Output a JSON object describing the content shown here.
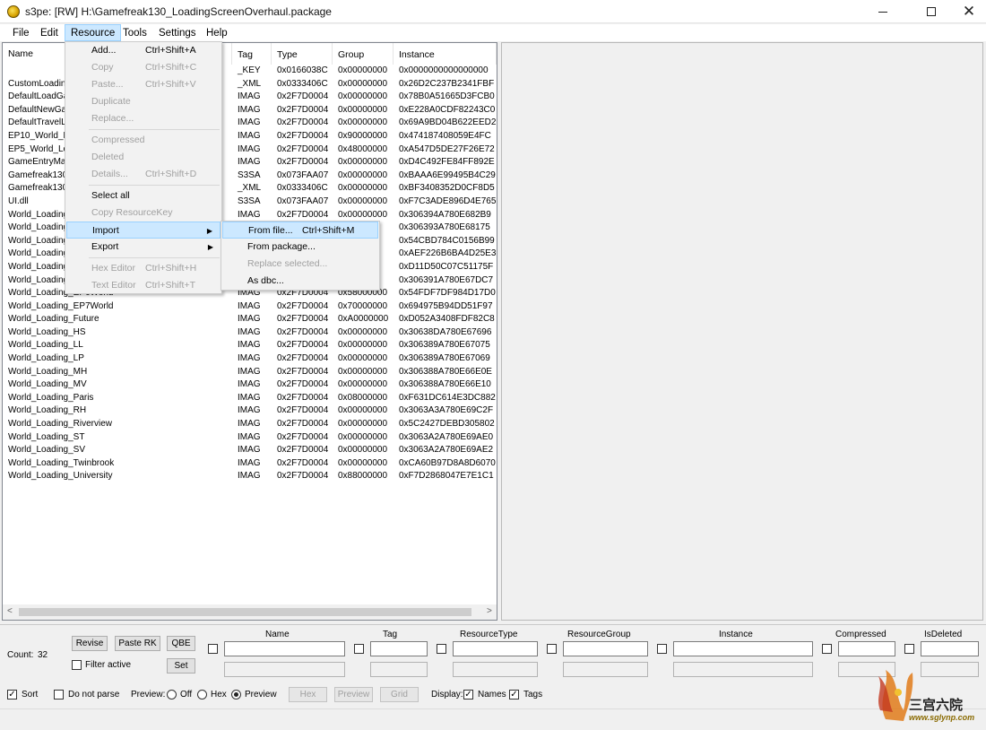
{
  "window": {
    "title": "s3pe: [RW] H:\\Gamefreak130_LoadingScreenOverhaul.package",
    "close_glyph": "✕"
  },
  "menubar": [
    "File",
    "Edit",
    "Resource",
    "Tools",
    "Settings",
    "Help"
  ],
  "list": {
    "columns": [
      "Name",
      "Tag",
      "Type",
      "Group",
      "Instance"
    ],
    "rows": [
      {
        "name": "",
        "tag": "_KEY",
        "type": "0x0166038C",
        "group": "0x00000000",
        "instance": "0x0000000000000000"
      },
      {
        "name": "CustomLoading",
        "tag": "_XML",
        "type": "0x0333406C",
        "group": "0x00000000",
        "instance": "0x26D2C237B2341FBF"
      },
      {
        "name": "DefaultLoadGa",
        "tag": "IMAG",
        "type": "0x2F7D0004",
        "group": "0x00000000",
        "instance": "0x78B0A51665D3FCB0"
      },
      {
        "name": "DefaultNewGar",
        "tag": "IMAG",
        "type": "0x2F7D0004",
        "group": "0x00000000",
        "instance": "0xE228A0CDF82243C0"
      },
      {
        "name": "DefaultTravelLo",
        "tag": "IMAG",
        "type": "0x2F7D0004",
        "group": "0x00000000",
        "instance": "0x69A9BD04B622EED2"
      },
      {
        "name": "EP10_World_L",
        "tag": "IMAG",
        "type": "0x2F7D0004",
        "group": "0x90000000",
        "instance": "0x474187408059E4FC"
      },
      {
        "name": "EP5_World_Lo",
        "tag": "IMAG",
        "type": "0x2F7D0004",
        "group": "0x48000000",
        "instance": "0xA547D5DE27F26E72"
      },
      {
        "name": "GameEntryMain",
        "tag": "IMAG",
        "type": "0x2F7D0004",
        "group": "0x00000000",
        "instance": "0xD4C492FE84FF892E"
      },
      {
        "name": "Gamefreak130.",
        "tag": "S3SA",
        "type": "0x073FAA07",
        "group": "0x00000000",
        "instance": "0xBAAA6E99495B4C29"
      },
      {
        "name": "Gamefreak130.",
        "tag": "_XML",
        "type": "0x0333406C",
        "group": "0x00000000",
        "instance": "0xBF3408352D0CF8D5"
      },
      {
        "name": "UI.dll",
        "tag": "S3SA",
        "type": "0x073FAA07",
        "group": "0x00000000",
        "instance": "0xF7C3ADE896D4E765"
      },
      {
        "name": "World_Loading",
        "tag": "IMAG",
        "type": "0x2F7D0004",
        "group": "0x00000000",
        "instance": "0x306394A780E682B9"
      },
      {
        "name": "World_Loading",
        "tag": "",
        "type": "",
        "group": "",
        "instance": "0x306393A780E68175"
      },
      {
        "name": "World_Loading",
        "tag": "",
        "type": "",
        "group": "",
        "instance": "0x54CBD784C0156B99"
      },
      {
        "name": "World_Loading",
        "tag": "",
        "type": "",
        "group": "",
        "instance": "0xAEF226B6BA4D25E3"
      },
      {
        "name": "World_Loading",
        "tag": "",
        "type": "",
        "group": "",
        "instance": "0xD11D50C07C51175F"
      },
      {
        "name": "World_Loading",
        "tag": "",
        "type": "",
        "group": "",
        "instance": "0x306391A780E67DC7"
      },
      {
        "name": "World_Loading_EP6World",
        "tag": "IMAG",
        "type": "0x2F7D0004",
        "group": "0x58000000",
        "instance": "0x54FDF7DF984D17D0"
      },
      {
        "name": "World_Loading_EP7World",
        "tag": "IMAG",
        "type": "0x2F7D0004",
        "group": "0x70000000",
        "instance": "0x694975B94DD51F97"
      },
      {
        "name": "World_Loading_Future",
        "tag": "IMAG",
        "type": "0x2F7D0004",
        "group": "0xA0000000",
        "instance": "0xD052A3408FDF82C8"
      },
      {
        "name": "World_Loading_HS",
        "tag": "IMAG",
        "type": "0x2F7D0004",
        "group": "0x00000000",
        "instance": "0x30638DA780E67696"
      },
      {
        "name": "World_Loading_LL",
        "tag": "IMAG",
        "type": "0x2F7D0004",
        "group": "0x00000000",
        "instance": "0x306389A780E67075"
      },
      {
        "name": "World_Loading_LP",
        "tag": "IMAG",
        "type": "0x2F7D0004",
        "group": "0x00000000",
        "instance": "0x306389A780E67069"
      },
      {
        "name": "World_Loading_MH",
        "tag": "IMAG",
        "type": "0x2F7D0004",
        "group": "0x00000000",
        "instance": "0x306388A780E66E0E"
      },
      {
        "name": "World_Loading_MV",
        "tag": "IMAG",
        "type": "0x2F7D0004",
        "group": "0x00000000",
        "instance": "0x306388A780E66E10"
      },
      {
        "name": "World_Loading_Paris",
        "tag": "IMAG",
        "type": "0x2F7D0004",
        "group": "0x08000000",
        "instance": "0xF631DC614E3DC882"
      },
      {
        "name": "World_Loading_RH",
        "tag": "IMAG",
        "type": "0x2F7D0004",
        "group": "0x00000000",
        "instance": "0x3063A3A780E69C2F"
      },
      {
        "name": "World_Loading_Riverview",
        "tag": "IMAG",
        "type": "0x2F7D0004",
        "group": "0x00000000",
        "instance": "0x5C2427DEBD305802"
      },
      {
        "name": "World_Loading_ST",
        "tag": "IMAG",
        "type": "0x2F7D0004",
        "group": "0x00000000",
        "instance": "0x3063A2A780E69AE0"
      },
      {
        "name": "World_Loading_SV",
        "tag": "IMAG",
        "type": "0x2F7D0004",
        "group": "0x00000000",
        "instance": "0x3063A2A780E69AE2"
      },
      {
        "name": "World_Loading_Twinbrook",
        "tag": "IMAG",
        "type": "0x2F7D0004",
        "group": "0x00000000",
        "instance": "0xCA60B97D8A8D6070"
      },
      {
        "name": "World_Loading_University",
        "tag": "IMAG",
        "type": "0x2F7D0004",
        "group": "0x88000000",
        "instance": "0xF7D2868047E7E1C1"
      }
    ]
  },
  "resource_menu": {
    "items": [
      {
        "label": "Add...",
        "shortcut": "Ctrl+Shift+A",
        "enabled": true
      },
      {
        "label": "Copy",
        "shortcut": "Ctrl+Shift+C",
        "enabled": false
      },
      {
        "label": "Paste...",
        "shortcut": "Ctrl+Shift+V",
        "enabled": false
      },
      {
        "label": "Duplicate",
        "shortcut": "",
        "enabled": false
      },
      {
        "label": "Replace...",
        "shortcut": "",
        "enabled": false
      },
      {
        "label": "Compressed",
        "shortcut": "",
        "enabled": false
      },
      {
        "label": "Deleted",
        "shortcut": "",
        "enabled": false
      },
      {
        "label": "Details...",
        "shortcut": "Ctrl+Shift+D",
        "enabled": false
      },
      {
        "label": "Select all",
        "shortcut": "",
        "enabled": true
      },
      {
        "label": "Copy ResourceKey",
        "shortcut": "",
        "enabled": false
      },
      {
        "label": "Import",
        "shortcut": "",
        "enabled": true,
        "submenu": true,
        "highlighted": true
      },
      {
        "label": "Export",
        "shortcut": "",
        "enabled": true,
        "submenu": true
      },
      {
        "label": "Hex Editor",
        "shortcut": "Ctrl+Shift+H",
        "enabled": false
      },
      {
        "label": "Text Editor",
        "shortcut": "Ctrl+Shift+T",
        "enabled": false
      }
    ],
    "arrow_glyph": "▶"
  },
  "import_submenu": {
    "items": [
      {
        "label": "From file...",
        "shortcut": "Ctrl+Shift+M",
        "enabled": true,
        "highlighted": true
      },
      {
        "label": "From package...",
        "shortcut": "",
        "enabled": true
      },
      {
        "label": "Replace selected...",
        "shortcut": "",
        "enabled": false
      },
      {
        "label": "As dbc...",
        "shortcut": "",
        "enabled": true
      }
    ]
  },
  "bottom": {
    "count_label": "Count:",
    "count_value": "32",
    "revise": "Revise",
    "paste_rk": "Paste RK",
    "qbe": "QBE",
    "set": "Set",
    "filter_active": "Filter active",
    "filter_columns": [
      "Name",
      "Tag",
      "ResourceType",
      "ResourceGroup",
      "Instance",
      "Compressed",
      "IsDeleted"
    ],
    "sort": "Sort",
    "do_not_parse": "Do not parse",
    "preview_label": "Preview:",
    "off": "Off",
    "hex": "Hex",
    "preview": "Preview",
    "btn_hex": "Hex",
    "btn_preview": "Preview",
    "btn_grid": "Grid",
    "display_label": "Display:",
    "names": "Names",
    "tags": "Tags",
    "check_glyph": "✓"
  },
  "watermark": {
    "text": "三宫六院",
    "url": "www.sglynp.com"
  },
  "colors": {
    "highlight_bg": "#cce8ff",
    "highlight_border": "#99d1ff",
    "disabled_text": "#a0a0a0"
  }
}
